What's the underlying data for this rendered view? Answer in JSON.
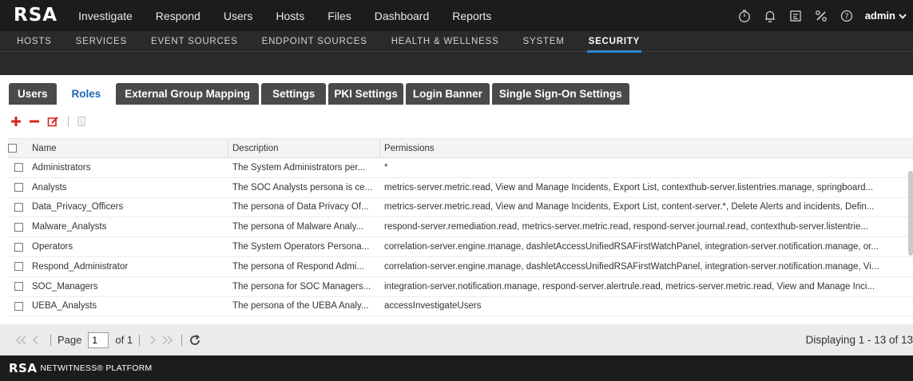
{
  "app": {
    "logo": "RSA",
    "nav": [
      "Investigate",
      "Respond",
      "Users",
      "Hosts",
      "Files",
      "Dashboard",
      "Reports"
    ],
    "icons": [
      "timer-icon",
      "bell-icon",
      "checklist-icon",
      "tools-icon",
      "help-icon"
    ],
    "user": "admin"
  },
  "subnav": {
    "items": [
      "HOSTS",
      "SERVICES",
      "EVENT SOURCES",
      "ENDPOINT SOURCES",
      "HEALTH & WELLNESS",
      "SYSTEM",
      "SECURITY"
    ],
    "active": "SECURITY"
  },
  "tabs": {
    "items": [
      "Users",
      "Roles",
      "External Group Mapping",
      "Settings",
      "PKI Settings",
      "Login Banner",
      "Single Sign-On Settings"
    ],
    "active": "Roles"
  },
  "toolbar": {
    "add": "add-icon",
    "remove": "remove-icon",
    "edit": "edit-icon",
    "copy": "copy-icon"
  },
  "grid": {
    "headers": {
      "name": "Name",
      "description": "Description",
      "permissions": "Permissions"
    },
    "rows": [
      {
        "name": "Administrators",
        "description": "The System Administrators per...",
        "permissions": "*"
      },
      {
        "name": "Analysts",
        "description": "The SOC Analysts persona is ce...",
        "permissions": "metrics-server.metric.read, View and Manage Incidents, Export List, contexthub-server.listentries.manage, springboard..."
      },
      {
        "name": "Data_Privacy_Officers",
        "description": "The persona of Data Privacy Of...",
        "permissions": "metrics-server.metric.read, View and Manage Incidents, Export List, content-server.*, Delete Alerts and incidents, Defin..."
      },
      {
        "name": "Malware_Analysts",
        "description": "The persona of Malware Analy...",
        "permissions": "respond-server.remediation.read, metrics-server.metric.read, respond-server.journal.read, contexthub-server.listentrie..."
      },
      {
        "name": "Operators",
        "description": "The System Operators Persona...",
        "permissions": "correlation-server.engine.manage, dashletAccessUnifiedRSAFirstWatchPanel, integration-server.notification.manage, or..."
      },
      {
        "name": "Respond_Administrator",
        "description": "The persona of Respond Admi...",
        "permissions": "correlation-server.engine.manage, dashletAccessUnifiedRSAFirstWatchPanel, integration-server.notification.manage, Vi..."
      },
      {
        "name": "SOC_Managers",
        "description": "The persona for SOC Managers...",
        "permissions": "integration-server.notification.manage, respond-server.alertrule.read, metrics-server.metric.read, View and Manage Inci..."
      },
      {
        "name": "UEBA_Analysts",
        "description": "The persona of the UEBA Analy...",
        "permissions": "accessInvestigateUsers"
      }
    ]
  },
  "paging": {
    "page_label": "Page",
    "page_value": "1",
    "of_label": "of 1",
    "display": "Displaying 1 - 13 of 13"
  },
  "footer": {
    "logo": "RSA",
    "text": "NETWITNESS® PLATFORM"
  },
  "colors": {
    "accent": "#2d86d4",
    "add": "#d9261c",
    "remove": "#d9261c",
    "active_tab_text": "#2069b3"
  }
}
